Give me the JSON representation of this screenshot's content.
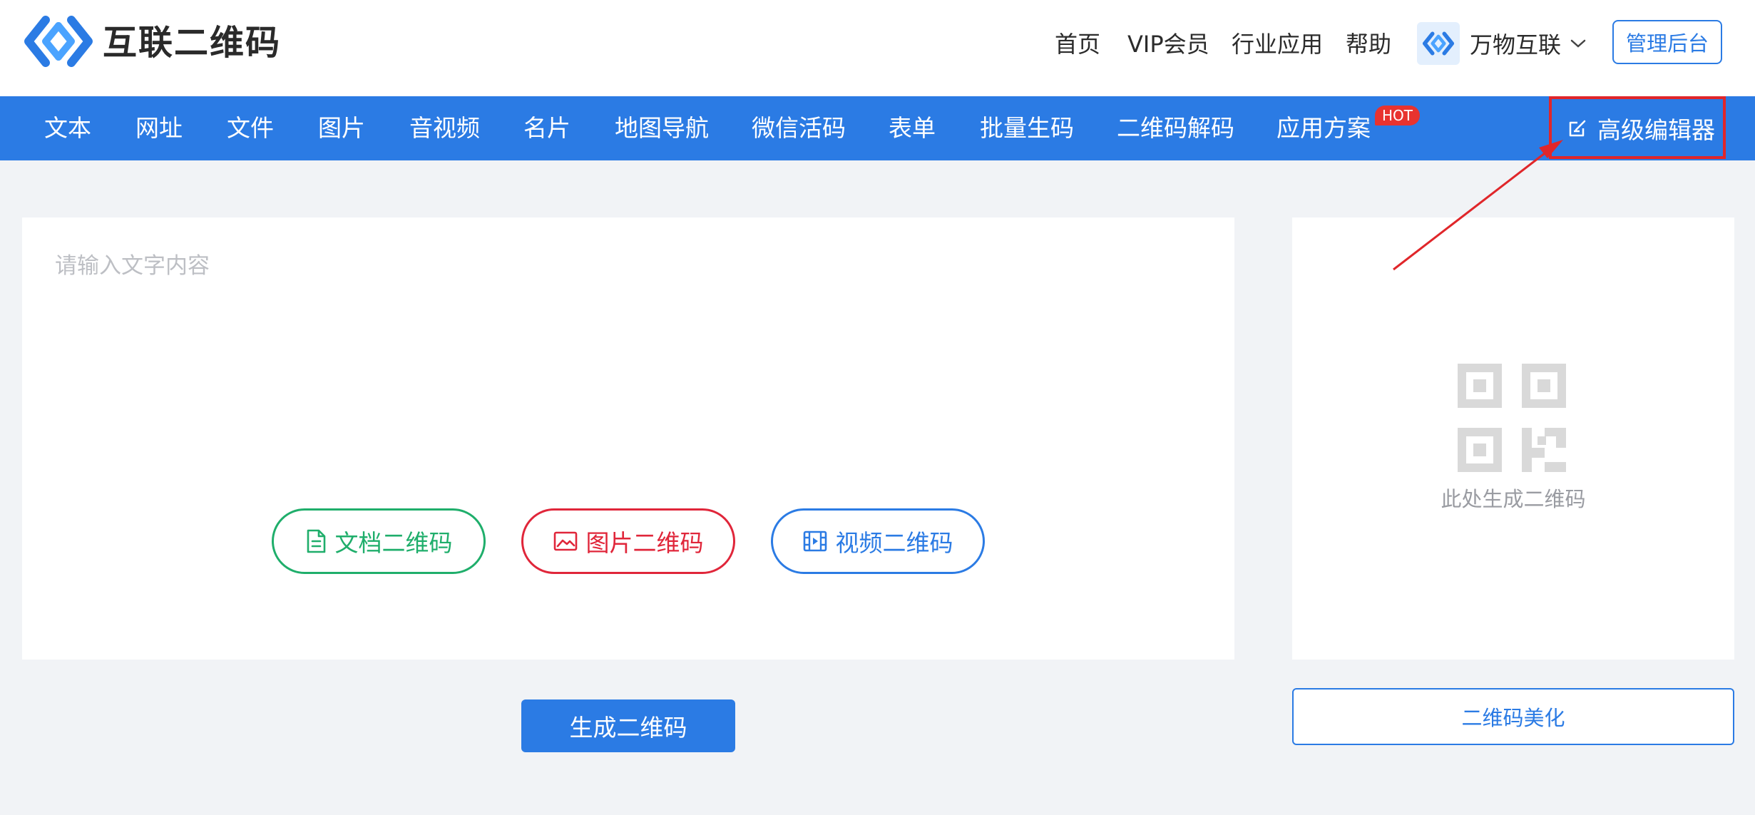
{
  "brand": {
    "name": "互联二维码"
  },
  "top_nav": {
    "items": [
      "首页",
      "VIP会员",
      "行业应用",
      "帮助"
    ],
    "account_label": "万物互联",
    "admin_button": "管理后台"
  },
  "category_nav": {
    "items": [
      "文本",
      "网址",
      "文件",
      "图片",
      "音视频",
      "名片",
      "地图导航",
      "微信活码",
      "表单",
      "批量生码",
      "二维码解码",
      "应用方案"
    ],
    "hot_badge": "HOT",
    "advanced_editor": "高级编辑器"
  },
  "input_panel": {
    "placeholder": "请输入文字内容",
    "pills": {
      "doc": "文档二维码",
      "image": "图片二维码",
      "video": "视频二维码"
    }
  },
  "generate_button": "生成二维码",
  "qr_panel": {
    "caption": "此处生成二维码"
  },
  "beautify_button": "二维码美化",
  "colors": {
    "primary": "#2b7be4",
    "background": "#f1f3f6",
    "highlight_red": "#e0262a",
    "doc_green": "#1fae6b",
    "image_red": "#e0263a",
    "hot_badge": "#e8332f"
  },
  "annotations": {
    "highlight": "red-box-around-advanced-editor",
    "arrow": "red-arrow-pointing-to-advanced-editor"
  }
}
